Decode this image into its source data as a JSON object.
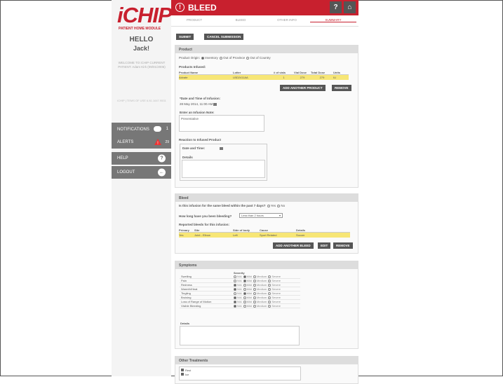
{
  "header": {
    "title": "BLEED",
    "help": "?",
    "home": "⌂"
  },
  "logo": {
    "text": "iCHIP",
    "subtitle": "PATIENT HOME MODULE"
  },
  "greeting": {
    "hello": "HELLO",
    "name": "Jack!",
    "welcome": "WELCOME TO iCHIP CURRENT PATIENT: Adam Kirk (09/01/2005)",
    "footer": "iCHIP | TEMS OF USE 6.81.1647.9531"
  },
  "nav": {
    "notifications": "NOTIFICATIONS",
    "notifications_count": "1",
    "alerts": "ALERTS",
    "alerts_count": "29",
    "help": "HELP",
    "logout": "LOGOUT"
  },
  "tabs": [
    "PRODUCT",
    "BLEED",
    "OTHER INFO",
    "SUMMARY"
  ],
  "actions": {
    "submit": "SUBMIT",
    "cancel": "CANCEL SUBMISSION"
  },
  "product": {
    "title": "Product",
    "origin_label": "Product Origin:",
    "origin_options": [
      "Inventory",
      "Out of Province",
      "Out of Country"
    ],
    "infused_label": "Products Infused:",
    "columns": [
      "Product Name",
      "Lotter",
      "# of vials",
      "Vial Dose",
      "Total Dose",
      "Units"
    ],
    "rows": [
      [
        "Advate",
        "LBD2411AA",
        "1",
        "279",
        "279",
        "IU"
      ]
    ],
    "add_button": "ADD ANOTHER PRODUCT",
    "remove_button": "REMOVE",
    "datetime_label": "*Date and Time of Infusion:",
    "datetime_value": "28 May 2014, 11:00 AM",
    "notes_label": "Enter an Infusion Note:",
    "notes_value": "Preventative"
  },
  "reaction": {
    "title": "Reaction to Infused Product",
    "datetime_label": "Date and Time:",
    "details_label": "Details"
  },
  "bleed": {
    "title": "Bleed",
    "q1": "Is this infusion for the same bleed within the past 7 days?",
    "q1_options": [
      "Yes",
      "No"
    ],
    "q2": "How long have you been bleeding?",
    "q2_value": "Less than 2 hours",
    "reported_label": "Reported bleeds for this infusion:",
    "columns": [
      "Primary",
      "Site",
      "Side of body",
      "Cause",
      "Details"
    ],
    "rows": [
      [
        "Yes",
        "Joint - Elbow",
        "Left",
        "Sport Related",
        "Soccer"
      ]
    ],
    "add_button": "ADD ANOTHER BLEED",
    "edit_button": "EDIT",
    "remove_button": "REMOVE"
  },
  "symptoms": {
    "title": "Symptoms",
    "severity_label": "Severity",
    "severity_options": "N/A  Mild  Medium  Severe",
    "rows": [
      {
        "name": "Swelling",
        "sel": 1
      },
      {
        "name": "Pain",
        "sel": 1
      },
      {
        "name": "Redness",
        "sel": 0
      },
      {
        "name": "Warmth/Heat",
        "sel": 0
      },
      {
        "name": "Tingling",
        "sel": 1
      },
      {
        "name": "Bruising",
        "sel": 0
      },
      {
        "name": "Loss of Range of Motion",
        "sel": 0
      },
      {
        "name": "Visible Bleeding",
        "sel": 0
      }
    ],
    "details_label": "Details"
  },
  "other": {
    "title": "Other Treatments",
    "items": [
      "Rest",
      "Ice"
    ]
  }
}
